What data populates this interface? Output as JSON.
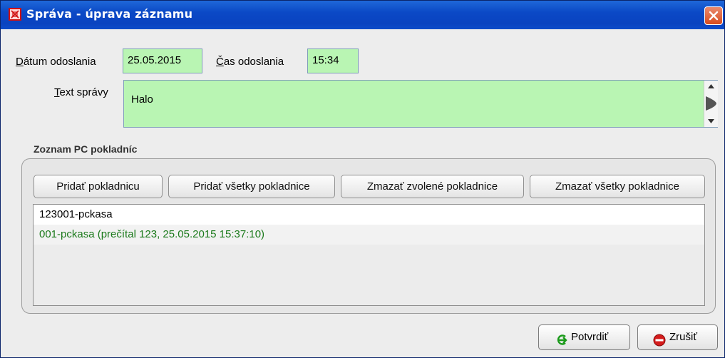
{
  "window": {
    "title": "Správa - úprava záznamu"
  },
  "form": {
    "date_label": "Dátum odoslania",
    "date_value": "25.05.2015",
    "time_label": "Čas odoslania",
    "time_value": "15:34",
    "message_label": "Text správy",
    "message_value": "Halo"
  },
  "group": {
    "title": "Zoznam PC pokladníc",
    "buttons": [
      "Pridať pokladnicu",
      "Pridať všetky pokladnice",
      "Zmazať zvolené pokladnice",
      "Zmazať všetky pokladnice"
    ],
    "list_items": [
      "123001-pckasa",
      "001-pckasa (prečítal 123, 25.05.2015 15:37:10)"
    ]
  },
  "footer": {
    "confirm_label": "Potvrdiť",
    "cancel_label": "Zrušiť"
  },
  "colors": {
    "field_bg": "#b9f5b3",
    "read_item_text": "#1b7a1b",
    "title_bar": "#0b49c6"
  },
  "icons": [
    "app-icon",
    "close-icon",
    "scroll-up-icon",
    "scroll-down-icon",
    "confirm-arrow-icon",
    "cancel-stop-icon"
  ]
}
